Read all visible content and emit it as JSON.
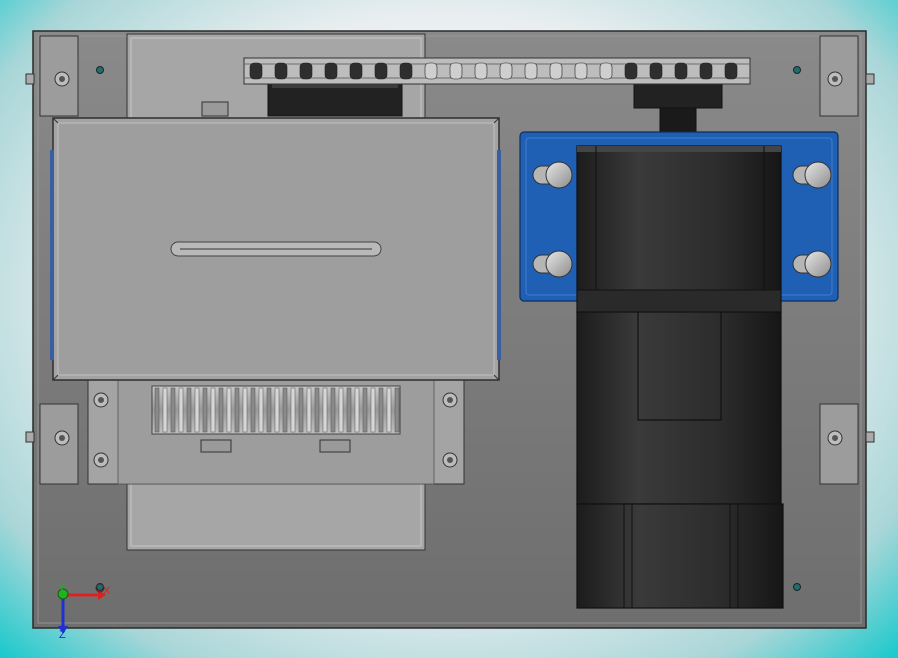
{
  "viewport": {
    "background_center": "#ffffff",
    "background_edge": "#17c9cc"
  },
  "model": {
    "base_plate_color": "#7a7a7a",
    "sheet_metal_color": "#a0a0a0",
    "motor_color": "#2b2b2b",
    "motor_mount_color": "#1f5fb4",
    "chain_color": "#b9b9b9"
  },
  "triad": {
    "x_label": "X",
    "y_label": "Y",
    "z_label": "Z",
    "x_color": "#e02020",
    "y_color": "#20b020",
    "z_color": "#2030d0",
    "x_label_icon": "axis-x-arrow",
    "y_label_icon": "axis-y-arrow",
    "z_label_icon": "axis-z-arrow"
  }
}
